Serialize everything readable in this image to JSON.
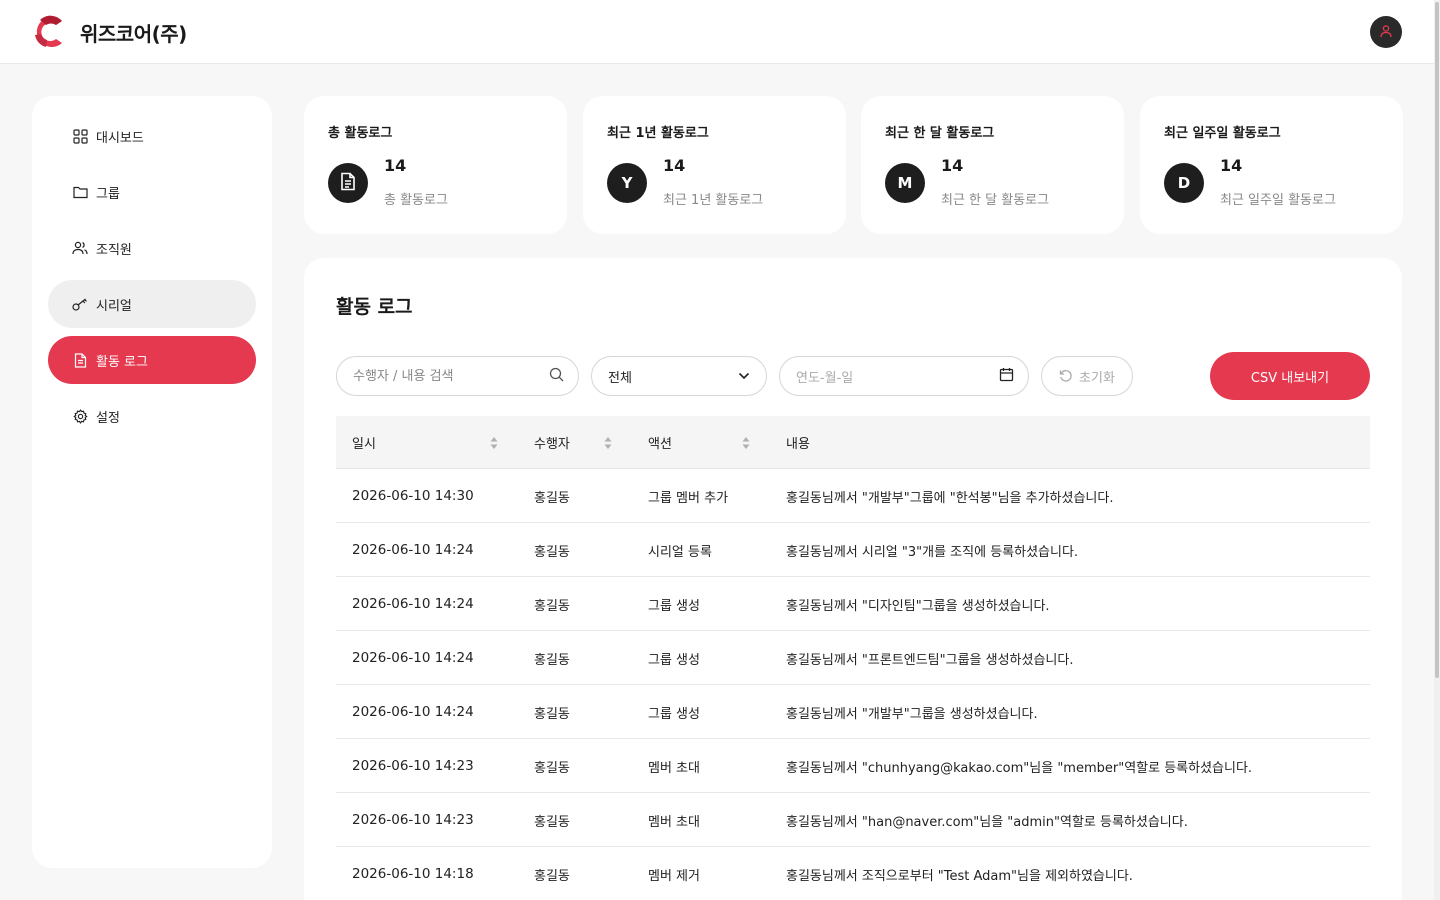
{
  "header": {
    "company_name": "위즈코어(주)",
    "brand_color": "#e5394f"
  },
  "sidebar": {
    "items": [
      {
        "label": "대시보드",
        "icon": "dashboard-icon",
        "state": "default"
      },
      {
        "label": "그룹",
        "icon": "folder-icon",
        "state": "default"
      },
      {
        "label": "조직원",
        "icon": "users-icon",
        "state": "default"
      },
      {
        "label": "시리얼",
        "icon": "key-icon",
        "state": "hover"
      },
      {
        "label": "활동 로그",
        "icon": "document-icon",
        "state": "active"
      },
      {
        "label": "설정",
        "icon": "gear-icon",
        "state": "default"
      }
    ]
  },
  "stats": [
    {
      "title": "총 활동로그",
      "badge": "",
      "badge_icon": "document-icon",
      "value": "14",
      "subtitle": "총 활동로그"
    },
    {
      "title": "최근 1년 활동로그",
      "badge": "Y",
      "value": "14",
      "subtitle": "최근 1년 활동로그"
    },
    {
      "title": "최근 한 달 활동로그",
      "badge": "M",
      "value": "14",
      "subtitle": "최근 한 달 활동로그"
    },
    {
      "title": "최근 일주일 활동로그",
      "badge": "D",
      "value": "14",
      "subtitle": "최근 일주일 활동로그"
    }
  ],
  "log_panel": {
    "title": "활동 로그",
    "search_placeholder": "수행자 / 내용 검색",
    "filter_value": "전체",
    "date_placeholder": "연도-월-일",
    "reset_label": "초기화",
    "csv_label": "CSV 내보내기",
    "columns": [
      "일시",
      "수행자",
      "액션",
      "내용"
    ],
    "rows": [
      {
        "date": "2026-06-10 14:30",
        "actor": "홍길동",
        "action": "그룹 멤버 추가",
        "content": "홍길동님께서 \"개발부\"그룹에 \"한석봉\"님을 추가하셨습니다."
      },
      {
        "date": "2026-06-10 14:24",
        "actor": "홍길동",
        "action": "시리얼 등록",
        "content": "홍길동님께서 시리얼 \"3\"개를 조직에 등록하셨습니다."
      },
      {
        "date": "2026-06-10 14:24",
        "actor": "홍길동",
        "action": "그룹 생성",
        "content": "홍길동님께서 \"디자인팀\"그룹을 생성하셨습니다."
      },
      {
        "date": "2026-06-10 14:24",
        "actor": "홍길동",
        "action": "그룹 생성",
        "content": "홍길동님께서 \"프론트엔드팀\"그룹을 생성하셨습니다."
      },
      {
        "date": "2026-06-10 14:24",
        "actor": "홍길동",
        "action": "그룹 생성",
        "content": "홍길동님께서 \"개발부\"그룹을 생성하셨습니다."
      },
      {
        "date": "2026-06-10 14:23",
        "actor": "홍길동",
        "action": "멤버 초대",
        "content": "홍길동님께서 \"chunhyang@kakao.com\"님을 \"member\"역할로 등록하셨습니다."
      },
      {
        "date": "2026-06-10 14:23",
        "actor": "홍길동",
        "action": "멤버 초대",
        "content": "홍길동님께서 \"han@naver.com\"님을 \"admin\"역할로 등록하셨습니다."
      },
      {
        "date": "2026-06-10 14:18",
        "actor": "홍길동",
        "action": "멤버 제거",
        "content": "홍길동님께서 조직으로부터 \"Test Adam\"님을 제외하였습니다."
      }
    ]
  }
}
